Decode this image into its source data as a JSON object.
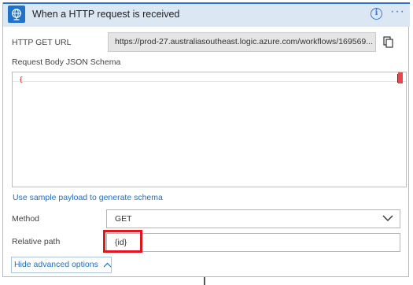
{
  "header": {
    "title": "When a HTTP request is received",
    "icons": {
      "trigger": "http-request-icon",
      "info": "info-icon",
      "more": "more-options-icon"
    },
    "accent_color": "#2872c7"
  },
  "fields": {
    "http_get_url_label": "HTTP GET URL",
    "http_get_url_value": "https://prod-27.australiasoutheast.logic.azure.com/workflows/169569...",
    "schema_label": "Request Body JSON Schema",
    "schema_value": "{",
    "sample_payload_link": "Use sample payload to generate schema",
    "method_label": "Method",
    "method_value": "GET",
    "relative_path_label": "Relative path",
    "relative_path_value": "{id}"
  },
  "advanced": {
    "label": "Hide advanced options"
  },
  "colors": {
    "highlight": "#e0161a",
    "link": "#1e6ec8"
  }
}
